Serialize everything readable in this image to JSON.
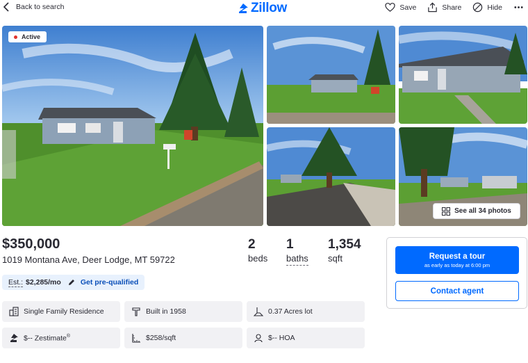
{
  "header": {
    "back_label": "Back to search",
    "logo_text": "Zillow",
    "brand_color": "#006aff",
    "save_label": "Save",
    "share_label": "Share",
    "hide_label": "Hide",
    "more_icon": "more-dots-icon"
  },
  "gallery": {
    "status_badge": "Active",
    "status_color": "#e0332e",
    "see_all_label": "See all 34 photos"
  },
  "listing": {
    "price": "$350,000",
    "address": "1019 Montana Ave, Deer Lodge, MT 59722",
    "beds_value": "2",
    "beds_label": "beds",
    "baths_value": "1",
    "baths_label": "baths",
    "sqft_value": "1,354",
    "sqft_label": "sqft",
    "est_label": "Est.:",
    "est_payment": "$2,285/mo",
    "prequal_label": "Get pre-qualified"
  },
  "facts": {
    "type": "Single Family Residence",
    "built": "Built in 1958",
    "lot": "0.37 Acres lot",
    "zestimate": "$-- Zestimate",
    "zestimate_mark": "®",
    "price_per_sqft": "$258/sqft",
    "hoa": "$-- HOA"
  },
  "contact": {
    "tour_label": "Request a tour",
    "tour_sub": "as early as today at 6:00 pm",
    "agent_label": "Contact agent"
  }
}
